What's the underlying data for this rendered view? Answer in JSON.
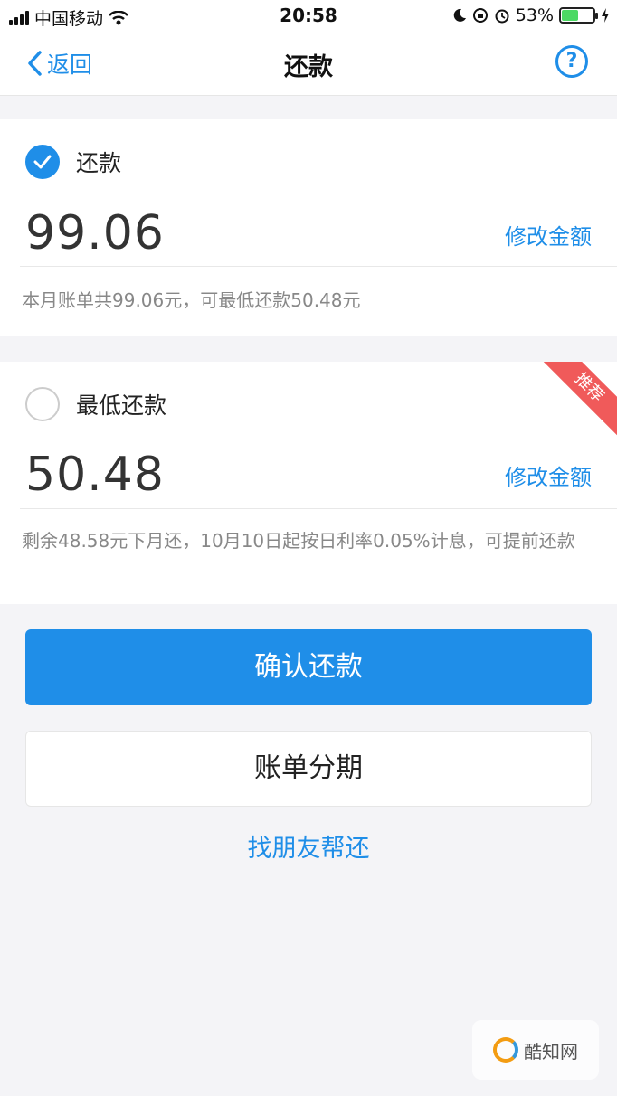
{
  "status_bar": {
    "carrier": "中国移动",
    "time": "20:58",
    "battery_percent": "53%",
    "battery_level": 0.53
  },
  "nav": {
    "back_label": "返回",
    "title": "还款",
    "help_label": "?"
  },
  "options": [
    {
      "label": "还款",
      "checked": true,
      "amount": "99.06",
      "edit_label": "修改金额",
      "note": "本月账单共99.06元，可最低还款50.48元"
    },
    {
      "label": "最低还款",
      "checked": false,
      "amount": "50.48",
      "edit_label": "修改金额",
      "note": "剩余48.58元下月还，10月10日起按日利率0.05%计息，可提前还款",
      "badge": "推荐"
    }
  ],
  "actions": {
    "confirm_label": "确认还款",
    "installment_label": "账单分期",
    "friend_label": "找朋友帮还"
  },
  "watermark": {
    "text": "酷知网"
  },
  "colors": {
    "accent": "#1f8ee8",
    "badge": "#f05a5a",
    "battery": "#4cd964"
  }
}
